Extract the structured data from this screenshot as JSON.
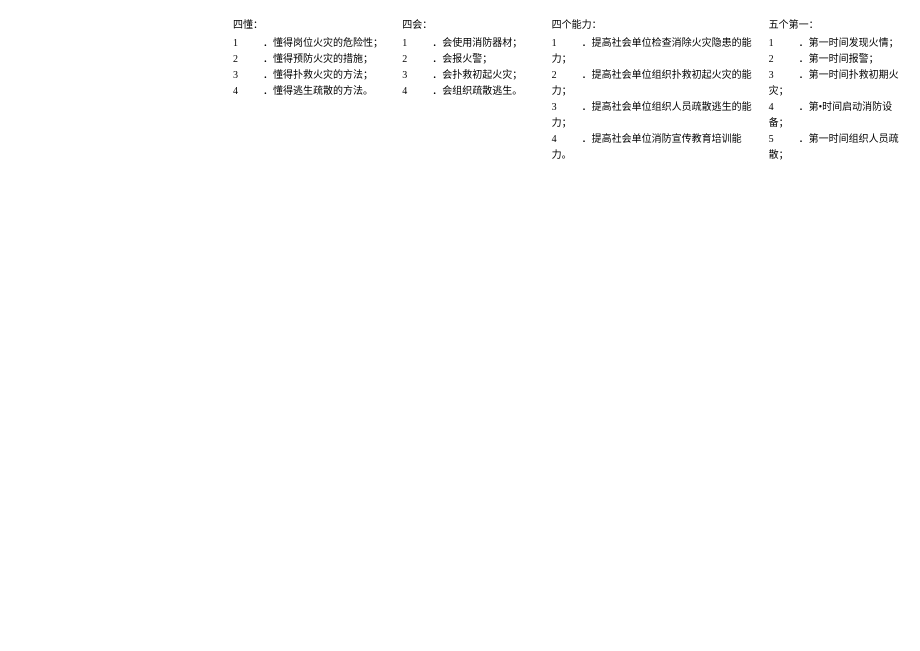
{
  "col1": {
    "title": "四懂：",
    "items": [
      {
        "num": "1",
        "txt": "．懂得岗位火灾的危险性；"
      },
      {
        "num": "2",
        "txt": "．懂得预防火灾的措施；"
      },
      {
        "num": "3",
        "txt": "．懂得扑救火灾的方法；"
      },
      {
        "num": "4",
        "txt": "．懂得逃生疏散的方法。"
      }
    ]
  },
  "col2": {
    "title": "四会：",
    "items": [
      {
        "num": "1",
        "txt": "．会使用消防器材；"
      },
      {
        "num": "2",
        "txt": "．会报火警；"
      },
      {
        "num": "3",
        "txt": "．会扑救初起火灾；"
      },
      {
        "num": "4",
        "txt": "．会组织疏散逃生。"
      }
    ]
  },
  "col3": {
    "title": "四个能力：",
    "items": [
      {
        "num": "1",
        "txt": "．提高社会单位检查消除火灾隐患的能力；"
      },
      {
        "num": "2",
        "txt": "．提高社会单位组织扑救初起火灾的能力；"
      },
      {
        "num": "3",
        "txt": "．提高社会单位组织人员疏散逃生的能力；"
      },
      {
        "num": "4",
        "txt": "．提高社会单位消防宣传教育培训能力。"
      }
    ]
  },
  "col4": {
    "title": "五个第一：",
    "items": [
      {
        "num": "1",
        "txt": "．第一时间发现火情；"
      },
      {
        "num": "2",
        "txt": "．第一时间报警；"
      },
      {
        "num": "3",
        "txt": "．第一时间扑救初期火灾；"
      },
      {
        "num": "4",
        "txt": "．第•时间启动消防设备；"
      },
      {
        "num": "5",
        "txt": "．第一时间组织人员疏散；"
      }
    ]
  }
}
